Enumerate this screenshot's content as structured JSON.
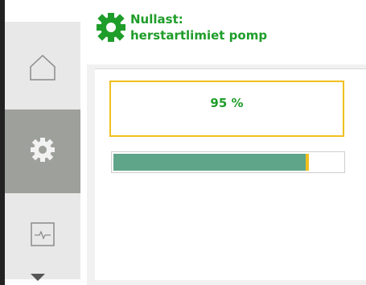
{
  "header": {
    "icon": "gear-icon",
    "title_line1": "Nullast:",
    "title_line2": "herstartlimiet pomp",
    "accent_color": "#1f9d2a"
  },
  "nav": {
    "items": [
      {
        "icon": "home-icon",
        "selected": false
      },
      {
        "icon": "gear-icon",
        "selected": true
      },
      {
        "icon": "monitor-icon",
        "selected": false
      }
    ],
    "scroll_indicator": "chevron-down-icon"
  },
  "main": {
    "value_label": "95 %",
    "progress_fraction": 0.84,
    "highlight_color": "#f0c020",
    "bar_color": "#5fa58a"
  }
}
